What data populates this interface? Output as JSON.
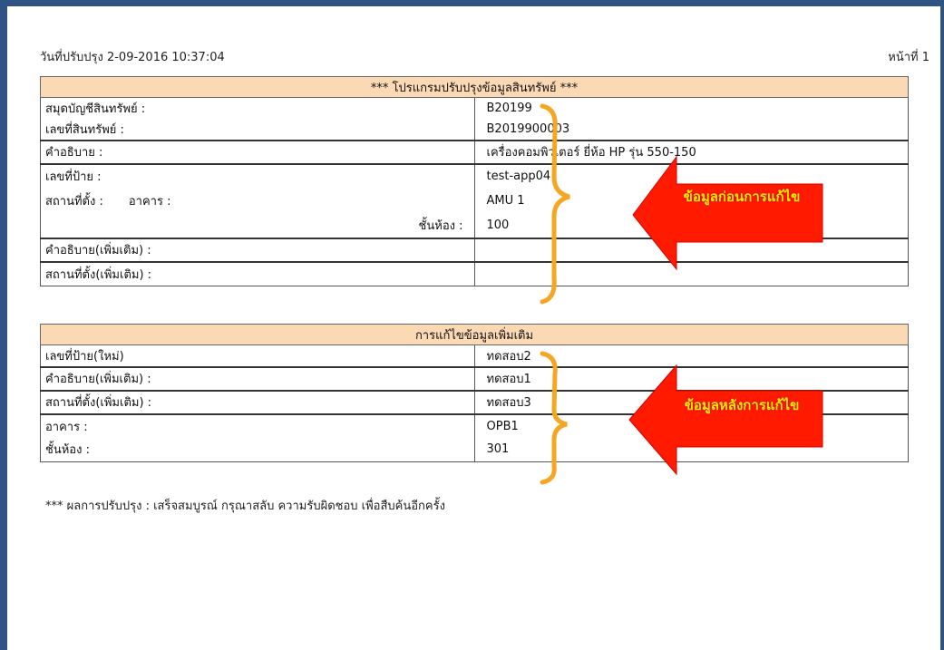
{
  "header": {
    "updated_date": "วันที่ปรับปรุง 2-09-2016 10:37:04",
    "page_number": "หน้าที่ 1"
  },
  "before": {
    "title": "*** โปรแกรมปรับปรุงข้อมูลสินทรัพย์ ***",
    "asset_book_label": "สมุดบัญชีสินทรัพย์ :",
    "asset_book_value": "B20199",
    "asset_no_label": "เลขที่สินทรัพย์ :",
    "asset_no_value": "B2019900003",
    "description_label": "คำอธิบาย :",
    "description_value": "เครื่องคอมพิวเตอร์ ยี่ห้อ HP รุ่น 550-150",
    "tag_label": "เลขที่ป้าย :",
    "tag_value": "test-app04",
    "location_label": "สถานที่ตั้ง :",
    "building_label": "อาคาร :",
    "building_value": "AMU 1",
    "floor_label": "ชั้นห้อง :",
    "floor_value": "100",
    "extra_desc_label": "คำอธิบาย(เพิ่มเติม) :",
    "extra_desc_value": "",
    "extra_loc_label": "สถานที่ตั้ง(เพิ่มเติม) :",
    "extra_loc_value": ""
  },
  "after": {
    "title": "การแก้ไขข้อมูลเพิ่มเติม",
    "new_tag_label": "เลขที่ป้าย(ใหม่)",
    "new_tag_value": "ทดสอบ2",
    "extra_desc_label": "คำอธิบาย(เพิ่มเติม) :",
    "extra_desc_value": "ทดสอบ1",
    "extra_loc_label": "สถานที่ตั้ง(เพิ่มเติม) :",
    "extra_loc_value": "ทดสอบ3",
    "building_label": "อาคาร :",
    "building_value": "OPB1",
    "floor_label": "ชั้นห้อง :",
    "floor_value": "301"
  },
  "annotations": {
    "before_arrow": "ข้อมูลก่อนการแก้ไข",
    "after_arrow": "ข้อมูลหลังการแก้ไข",
    "arrow_color": "#ff1a00",
    "arrow_text_color": "#ffe800",
    "brace_color": "#f5a623"
  },
  "result_note": "*** ผลการปรับปรุง : เสร็จสมบูรณ์ กรุณาสลับ ความรับผิดชอบ เพื่อสืบค้นอีกครั้ง"
}
